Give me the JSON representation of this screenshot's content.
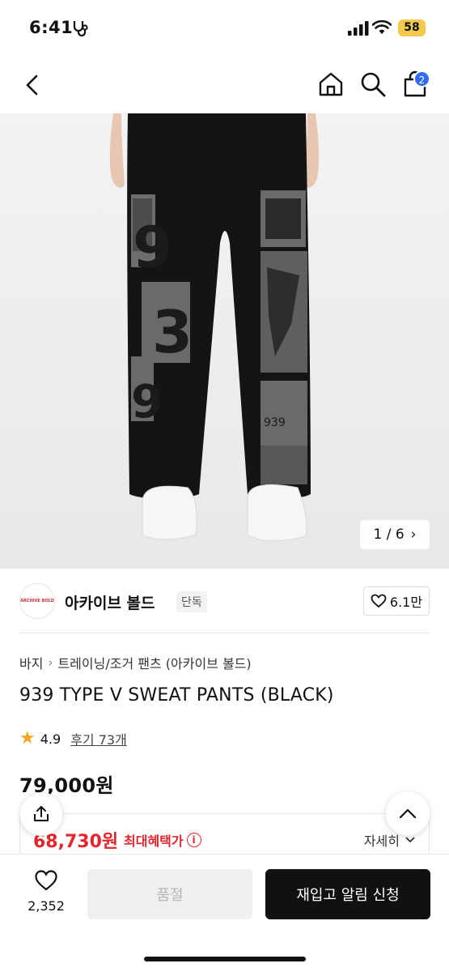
{
  "status": {
    "time": "6:41",
    "battery": "58"
  },
  "header": {
    "cart_count": "2"
  },
  "gallery": {
    "counter": "1 / 6"
  },
  "brand": {
    "logo_text": "ARCHIVE BOLD",
    "name": "아카이브 볼드",
    "badge": "단독",
    "likes": "6.1만"
  },
  "breadcrumb": {
    "category": "바지",
    "subcategory": "트레이닝/조거 팬츠 (아카이브 볼드)"
  },
  "product": {
    "title": "939 TYPE V SWEAT PANTS (BLACK)",
    "rating": "4.9",
    "reviews": "후기 73개",
    "price": "79,000원",
    "sale_price": "68,730원",
    "max_benefit_label": "최대혜택가",
    "detail_label": "자세히"
  },
  "bottom": {
    "wish_count": "2,352",
    "soldout_label": "품절",
    "restock_label": "재입고 알림 신청"
  },
  "colors": {
    "accent_red": "#e3262e",
    "badge_blue": "#2f6cf0",
    "star": "#f5a623"
  }
}
